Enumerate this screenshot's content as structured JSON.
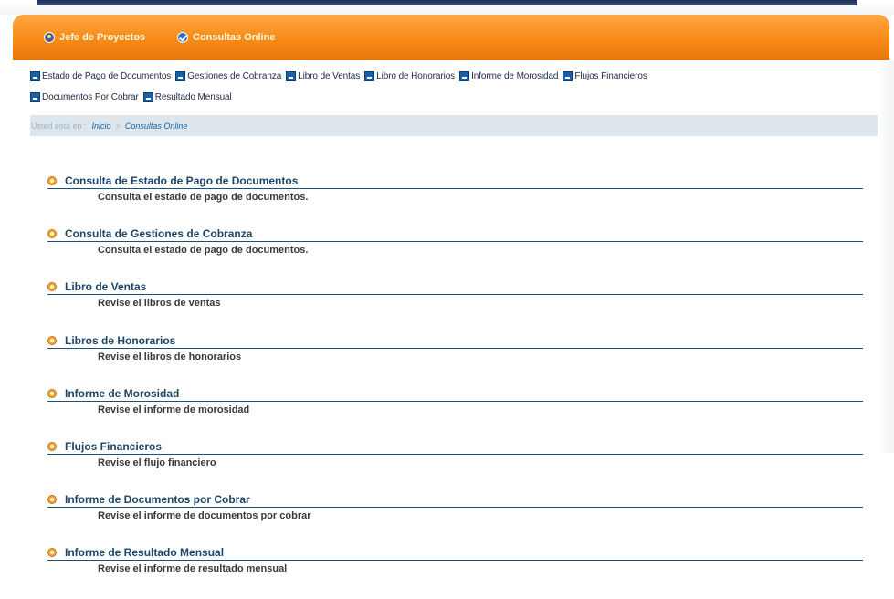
{
  "nav": {
    "items": [
      {
        "label": "Jefe de Proyectos",
        "icon": "person-icon"
      },
      {
        "label": "Consultas Online",
        "icon": "checkmark-icon"
      }
    ]
  },
  "quicklinks": {
    "row1": [
      "Estado de Pago de Documentos",
      "Gestiones de Cobranza",
      "Libro de Ventas",
      "Libro de Honorarios",
      "Informe de Morosidad",
      "Flujos Financieros"
    ],
    "row2": [
      "Documentos Por Cobrar",
      "Resultado Mensual"
    ]
  },
  "breadcrumb": {
    "prefix": "Usted está en :",
    "items": [
      "Inicio",
      "Consultas Online"
    ],
    "separator": ">"
  },
  "items": [
    {
      "title": "Consulta de Estado de Pago de Documentos",
      "desc": "Consulta el estado de pago de documentos."
    },
    {
      "title": "Consulta de Gestiones de Cobranza",
      "desc": "Consulta el estado de pago de documentos."
    },
    {
      "title": "Libro de Ventas",
      "desc": "Revise el libros de ventas"
    },
    {
      "title": "Libros de Honorarios",
      "desc": "Revise el libros de honorarios"
    },
    {
      "title": "Informe de Morosidad",
      "desc": "Revise el informe de morosidad"
    },
    {
      "title": "Flujos Financieros",
      "desc": "Revise el flujo financiero"
    },
    {
      "title": "Informe de Documentos por Cobrar",
      "desc": "Revise el informe de documentos por cobrar"
    },
    {
      "title": "Informe de Resultado Mensual",
      "desc": "Revise el informe de resultado mensual"
    }
  ],
  "colors": {
    "accent_orange": "#f88b16",
    "link_blue": "#1d5fa6",
    "title_navy": "#1f4566",
    "breadcrumb_bg": "#dce6ec"
  }
}
